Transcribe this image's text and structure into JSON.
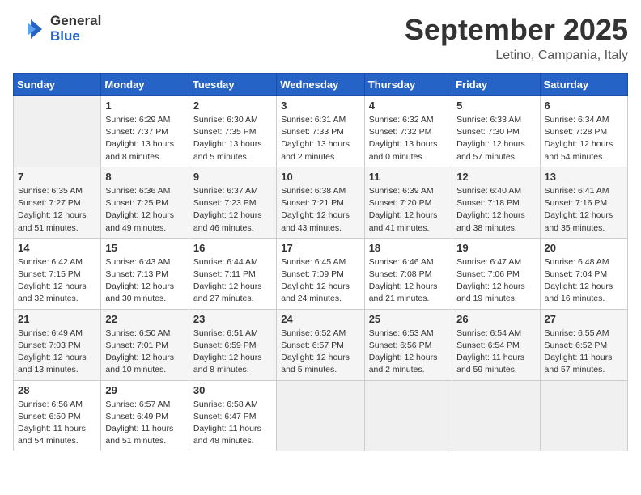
{
  "header": {
    "logo_general": "General",
    "logo_blue": "Blue",
    "month_title": "September 2025",
    "location": "Letino, Campania, Italy"
  },
  "weekdays": [
    "Sunday",
    "Monday",
    "Tuesday",
    "Wednesday",
    "Thursday",
    "Friday",
    "Saturday"
  ],
  "weeks": [
    [
      {
        "num": "",
        "empty": true
      },
      {
        "num": "1",
        "rise": "6:29 AM",
        "set": "7:37 PM",
        "daylight": "13 hours and 8 minutes."
      },
      {
        "num": "2",
        "rise": "6:30 AM",
        "set": "7:35 PM",
        "daylight": "13 hours and 5 minutes."
      },
      {
        "num": "3",
        "rise": "6:31 AM",
        "set": "7:33 PM",
        "daylight": "13 hours and 2 minutes."
      },
      {
        "num": "4",
        "rise": "6:32 AM",
        "set": "7:32 PM",
        "daylight": "13 hours and 0 minutes."
      },
      {
        "num": "5",
        "rise": "6:33 AM",
        "set": "7:30 PM",
        "daylight": "12 hours and 57 minutes."
      },
      {
        "num": "6",
        "rise": "6:34 AM",
        "set": "7:28 PM",
        "daylight": "12 hours and 54 minutes."
      }
    ],
    [
      {
        "num": "7",
        "rise": "6:35 AM",
        "set": "7:27 PM",
        "daylight": "12 hours and 51 minutes."
      },
      {
        "num": "8",
        "rise": "6:36 AM",
        "set": "7:25 PM",
        "daylight": "12 hours and 49 minutes."
      },
      {
        "num": "9",
        "rise": "6:37 AM",
        "set": "7:23 PM",
        "daylight": "12 hours and 46 minutes."
      },
      {
        "num": "10",
        "rise": "6:38 AM",
        "set": "7:21 PM",
        "daylight": "12 hours and 43 minutes."
      },
      {
        "num": "11",
        "rise": "6:39 AM",
        "set": "7:20 PM",
        "daylight": "12 hours and 41 minutes."
      },
      {
        "num": "12",
        "rise": "6:40 AM",
        "set": "7:18 PM",
        "daylight": "12 hours and 38 minutes."
      },
      {
        "num": "13",
        "rise": "6:41 AM",
        "set": "7:16 PM",
        "daylight": "12 hours and 35 minutes."
      }
    ],
    [
      {
        "num": "14",
        "rise": "6:42 AM",
        "set": "7:15 PM",
        "daylight": "12 hours and 32 minutes."
      },
      {
        "num": "15",
        "rise": "6:43 AM",
        "set": "7:13 PM",
        "daylight": "12 hours and 30 minutes."
      },
      {
        "num": "16",
        "rise": "6:44 AM",
        "set": "7:11 PM",
        "daylight": "12 hours and 27 minutes."
      },
      {
        "num": "17",
        "rise": "6:45 AM",
        "set": "7:09 PM",
        "daylight": "12 hours and 24 minutes."
      },
      {
        "num": "18",
        "rise": "6:46 AM",
        "set": "7:08 PM",
        "daylight": "12 hours and 21 minutes."
      },
      {
        "num": "19",
        "rise": "6:47 AM",
        "set": "7:06 PM",
        "daylight": "12 hours and 19 minutes."
      },
      {
        "num": "20",
        "rise": "6:48 AM",
        "set": "7:04 PM",
        "daylight": "12 hours and 16 minutes."
      }
    ],
    [
      {
        "num": "21",
        "rise": "6:49 AM",
        "set": "7:03 PM",
        "daylight": "12 hours and 13 minutes."
      },
      {
        "num": "22",
        "rise": "6:50 AM",
        "set": "7:01 PM",
        "daylight": "12 hours and 10 minutes."
      },
      {
        "num": "23",
        "rise": "6:51 AM",
        "set": "6:59 PM",
        "daylight": "12 hours and 8 minutes."
      },
      {
        "num": "24",
        "rise": "6:52 AM",
        "set": "6:57 PM",
        "daylight": "12 hours and 5 minutes."
      },
      {
        "num": "25",
        "rise": "6:53 AM",
        "set": "6:56 PM",
        "daylight": "12 hours and 2 minutes."
      },
      {
        "num": "26",
        "rise": "6:54 AM",
        "set": "6:54 PM",
        "daylight": "11 hours and 59 minutes."
      },
      {
        "num": "27",
        "rise": "6:55 AM",
        "set": "6:52 PM",
        "daylight": "11 hours and 57 minutes."
      }
    ],
    [
      {
        "num": "28",
        "rise": "6:56 AM",
        "set": "6:50 PM",
        "daylight": "11 hours and 54 minutes."
      },
      {
        "num": "29",
        "rise": "6:57 AM",
        "set": "6:49 PM",
        "daylight": "11 hours and 51 minutes."
      },
      {
        "num": "30",
        "rise": "6:58 AM",
        "set": "6:47 PM",
        "daylight": "11 hours and 48 minutes."
      },
      {
        "num": "",
        "empty": true
      },
      {
        "num": "",
        "empty": true
      },
      {
        "num": "",
        "empty": true
      },
      {
        "num": "",
        "empty": true
      }
    ]
  ]
}
